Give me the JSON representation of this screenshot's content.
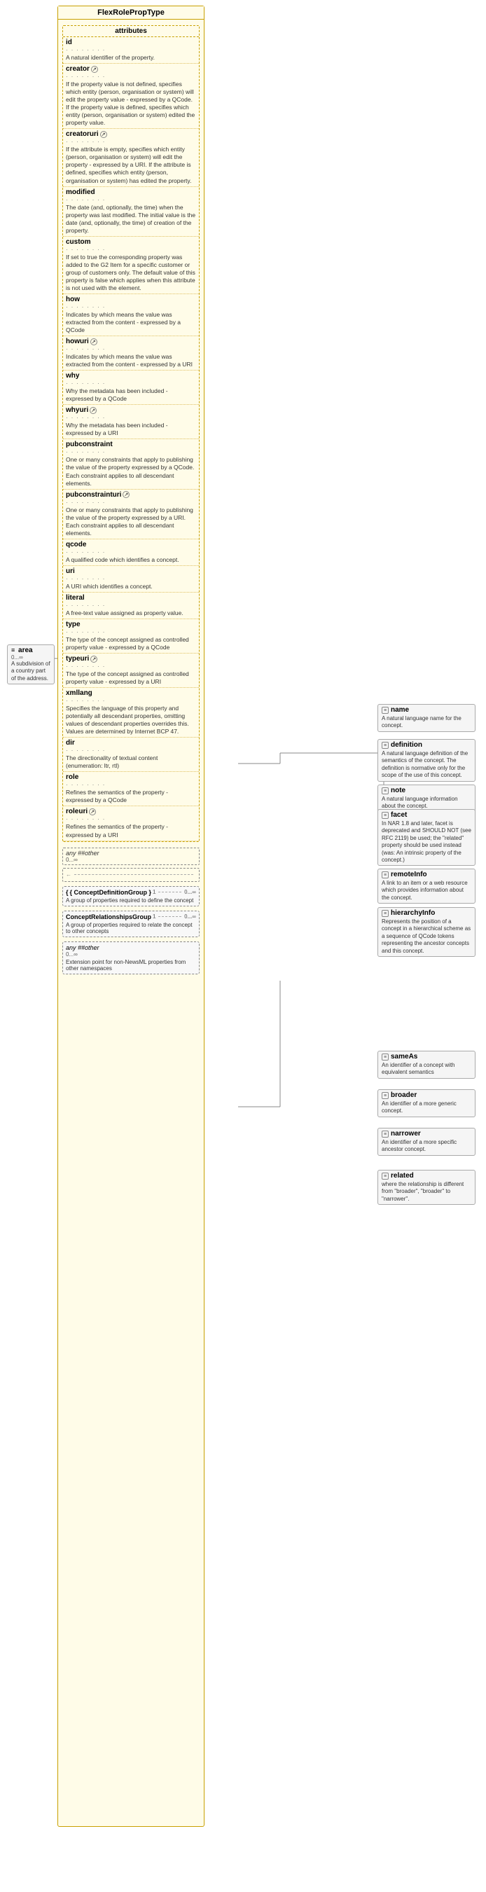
{
  "diagram": {
    "title": "FlexRolePropType",
    "attributes_label": "attributes",
    "attributes": [
      {
        "name": "id",
        "uri": false,
        "dots": "▲▲▲▲▲▲▲▲",
        "desc": "A natural identifier of the property."
      },
      {
        "name": "creator",
        "uri": true,
        "dots": "▲▲▲▲▲▲▲▲",
        "desc": "If the property value is not defined, specifies which entity (person, organisation or system) will edit the property value - expressed by a QCode. If the property value is defined, specifies which entity (person, organisation or system) edited the property value."
      },
      {
        "name": "creatoruri",
        "uri": true,
        "dots": "▲▲▲▲▲▲▲▲",
        "desc": "If the attribute is empty, specifies which entity (person, organisation or system) will edit the property - expressed by a URI. If the attribute is defined, specifies which entity (person, organisation or system) has edited the property."
      },
      {
        "name": "modified",
        "uri": false,
        "dots": "▲▲▲▲▲▲▲▲",
        "desc": "The date (and, optionally, the time) when the property was last modified. The initial value is the date (and, optionally, the time) of creation of the property."
      },
      {
        "name": "custom",
        "uri": false,
        "dots": "▲▲▲▲▲▲▲▲",
        "desc": "If set to true the corresponding property was added to the G2 Item for a specific customer or group of customers only. The default value of this property is false which applies when this attribute is not used with the element."
      },
      {
        "name": "how",
        "uri": false,
        "dots": "▲▲▲▲▲▲▲▲",
        "desc": "Indicates by which means the value was extracted from the content - expressed by a QCode"
      },
      {
        "name": "howuri",
        "uri": true,
        "dots": "▲▲▲▲▲▲▲▲",
        "desc": "Indicates by which means the value was extracted from the content - expressed by a URI"
      },
      {
        "name": "why",
        "uri": false,
        "dots": "▲▲▲▲▲▲▲▲",
        "desc": "Why the metadata has been included - expressed by a QCode"
      },
      {
        "name": "whyuri",
        "uri": true,
        "dots": "▲▲▲▲▲▲▲▲",
        "desc": "Why the metadata has been included - expressed by a URI"
      },
      {
        "name": "pubconstraint",
        "uri": false,
        "dots": "▲▲▲▲▲▲▲▲",
        "desc": "One or many constraints that apply to publishing the value of the property expressed by a QCode. Each constraint applies to all descendant elements."
      },
      {
        "name": "pubconstrainturi",
        "uri": true,
        "dots": "▲▲▲▲▲▲▲▲",
        "desc": "One or many constraints that apply to publishing the value of the property expressed by a URI. Each constraint applies to all descendant elements."
      },
      {
        "name": "qcode",
        "uri": false,
        "dots": "▲▲▲▲▲▲▲▲",
        "desc": "A qualified code which identifies a concept."
      },
      {
        "name": "uri",
        "uri": false,
        "dots": "▲▲▲▲▲▲▲▲",
        "desc": "A URI which identifies a concept."
      },
      {
        "name": "literal",
        "uri": false,
        "dots": "▲▲▲▲▲▲▲▲",
        "desc": "A free-text value assigned as property value."
      },
      {
        "name": "type",
        "uri": false,
        "dots": "▲▲▲▲▲▲▲▲",
        "desc": "The type of the concept assigned as controlled property value - expressed by a QCode"
      },
      {
        "name": "typeuri",
        "uri": true,
        "dots": "▲▲▲▲▲▲▲▲",
        "desc": "The type of the concept assigned as controlled property value - expressed by a URI"
      },
      {
        "name": "xmllang",
        "uri": false,
        "dots": "▲▲▲▲▲▲▲▲",
        "desc": "Specifies the language of this property and potentially all descendant properties, omitting values of descendant properties overrides this. Values are determined by Internet BCP 47."
      },
      {
        "name": "dir",
        "uri": false,
        "dots": "▲▲▲▲▲▲▲▲",
        "desc": "The directionality of textual content (enumeration: ltr, rtl)"
      },
      {
        "name": "role",
        "uri": false,
        "dots": "▲▲▲▲▲▲▲▲",
        "desc": "Refines the semantics of the property - expressed by a QCode"
      },
      {
        "name": "roleuri",
        "uri": true,
        "dots": "▲▲▲▲▲▲▲▲",
        "desc": "Refines the semantics of the property - expressed by a URI"
      }
    ],
    "any_other": {
      "label": "any ##other",
      "multiplicity": "0...∞"
    },
    "area_box": {
      "name": "area",
      "icon": "≡",
      "multiplicity": "0...∞",
      "desc": "A subdivision of a country part of the address."
    },
    "concept_def_group": {
      "name": "{ ConceptDefinitionGroup }",
      "desc": "A group of properties required to define the concept",
      "multiplicity_left": "1",
      "multiplicity_right": "0...∞"
    },
    "concept_rel_group": {
      "name": "ConceptRelationshipsGroup",
      "desc": "A group of properties required to relate the concept to other concepts",
      "multiplicity_left": "1",
      "multiplicity_right": "0...∞"
    },
    "any_other_bottom": {
      "label": "any ##other",
      "multiplicity": "0...∞",
      "desc": "Extension point for non-NewsML properties from other namespaces"
    },
    "right_properties": [
      {
        "id": "name",
        "name": "name",
        "icon": "≡",
        "desc": "A natural language name for the concept."
      },
      {
        "id": "definition",
        "name": "definition",
        "icon": "≡",
        "desc": "A natural language definition of the semantics of the concept. The definition is normative only for the scope of the use of this concept."
      },
      {
        "id": "note",
        "name": "note",
        "icon": "≡",
        "desc": "A natural language information about the concept."
      },
      {
        "id": "facet",
        "name": "facet",
        "icon": "≡",
        "desc": "In NAR 1.8 and later, facet is deprecated and SHOULD NOT (see RFC 2119) be used; the \"related\" property should be used instead (was: An intrinsic property of the concept.)"
      },
      {
        "id": "remoteinfo",
        "name": "remoteInfo",
        "icon": "≡",
        "desc": "A link to an item or a web resource which provides information about the concept."
      },
      {
        "id": "hierarchyinfo",
        "name": "hierarchyInfo",
        "icon": "≡",
        "desc": "Represents the position of a concept in a hierarchical scheme as a sequence of QCode tokens representing the ancestor concepts and this concept."
      },
      {
        "id": "sameas",
        "name": "sameAs",
        "icon": "≡",
        "desc": "An identifier of a concept with equivalent semantics"
      },
      {
        "id": "broader",
        "name": "broader",
        "icon": "≡",
        "desc": "An identifier of a more generic concept."
      },
      {
        "id": "narrower",
        "name": "narrower",
        "icon": "≡",
        "desc": "An identifier of a more specific ancestor concept."
      },
      {
        "id": "related",
        "name": "related",
        "icon": "≡",
        "desc": "where the relationship is different from \"broader\", \"broader\" to \"narrower\"."
      }
    ]
  }
}
